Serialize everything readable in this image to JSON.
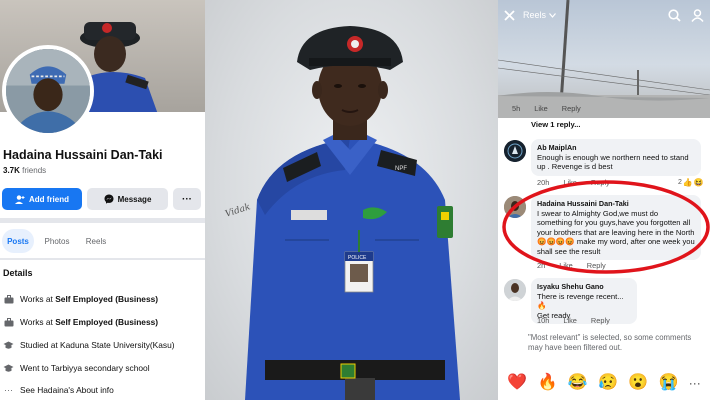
{
  "profile": {
    "name": "Hadaina Hussaini Dan-Taki",
    "friends_count": "3.7K",
    "friends_label": "friends",
    "add_friend_label": "Add friend",
    "message_label": "Message",
    "more_label": "···",
    "tabs": [
      {
        "label": "Posts",
        "active": true
      },
      {
        "label": "Photos",
        "active": false
      },
      {
        "label": "Reels",
        "active": false
      }
    ],
    "details_title": "Details",
    "details": [
      {
        "icon": "briefcase-icon",
        "prefix": "Works at ",
        "bold": "Self Employed (Business)"
      },
      {
        "icon": "briefcase-icon",
        "prefix": "Works at ",
        "bold": "Self Employed (Business)"
      },
      {
        "icon": "graduation-cap-icon",
        "prefix": "Studied at Kaduna State University(Kasu)",
        "bold": ""
      },
      {
        "icon": "graduation-cap-icon",
        "prefix": "Went to Tarbiyya secondary school",
        "bold": ""
      },
      {
        "icon": "more-icon",
        "prefix": "See Hadaina's About info",
        "bold": ""
      }
    ]
  },
  "photo": {
    "watermark": "Vidak",
    "chest_badge": "POLICE",
    "epaulette": "NPF",
    "arm_patch": "NIGERIA POLICE",
    "cap_color": "#1f2326",
    "uniform_color": "#2c52b8"
  },
  "reels": {
    "title": "Reels",
    "top_meta": {
      "time": "5h",
      "like": "Like",
      "reply": "Reply"
    },
    "view_replies": "View 1 reply...",
    "comments": [
      {
        "author": "Ab MaiplAn",
        "text": "Enough is enough we northern need to stand up . Revenge is d best",
        "time": "20h",
        "like": "Like",
        "reply": "Reply",
        "react_count": "2"
      },
      {
        "author": "Hadaina Hussaini Dan-Taki",
        "text": "I swear to Almighty God,we must do something for you guys,have you forgotten all your brothers that are leaving here in the North 😡😡😡😡 make my word, after one week you shall see the result",
        "time": "2h",
        "like": "Like",
        "reply": "Reply"
      },
      {
        "author": "Isyaku Shehu Gano",
        "text": "There is revenge recent...🔥",
        "text2": "Get ready",
        "time": "10h",
        "like": "Like",
        "reply": "Reply"
      }
    ],
    "notice": "\"Most relevant\" is selected, so some comments may have been filtered out.",
    "reactions": [
      "❤️",
      "🔥",
      "😂",
      "😥",
      "😮",
      "😭"
    ],
    "more": "···",
    "highlight_color": "#e0141b"
  },
  "colors": {
    "facebook_blue": "#1877f2",
    "button_gray": "#e4e6eb"
  }
}
